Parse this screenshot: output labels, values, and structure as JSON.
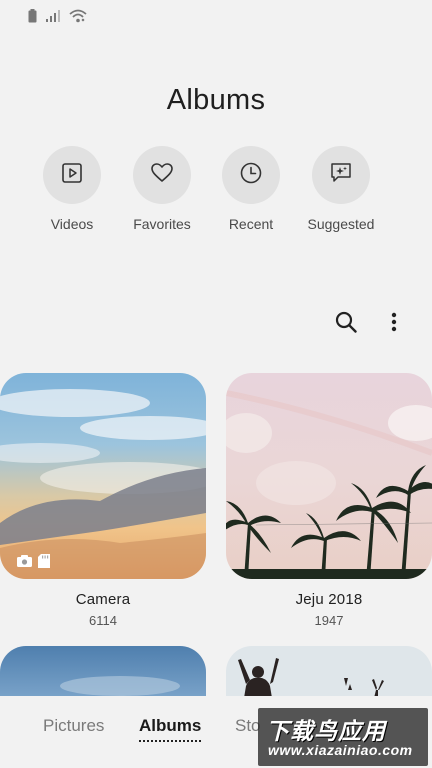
{
  "status_bar": {
    "icons": [
      "battery-icon",
      "cellular-signal-icon",
      "wifi-icon"
    ]
  },
  "header": {
    "title": "Albums"
  },
  "shortcuts": [
    {
      "label": "Videos",
      "icon": "video-play-icon"
    },
    {
      "label": "Favorites",
      "icon": "heart-icon"
    },
    {
      "label": "Recent",
      "icon": "clock-icon"
    },
    {
      "label": "Suggested",
      "icon": "sparkle-chat-icon"
    }
  ],
  "toolbar": {
    "icons": [
      "search-icon",
      "more-options-icon"
    ]
  },
  "albums": [
    {
      "name": "Camera",
      "count": "6114",
      "badges": [
        "camera-icon",
        "sd-card-icon"
      ]
    },
    {
      "name": "Jeju 2018",
      "count": "1947"
    },
    {
      "name": "",
      "count": ""
    },
    {
      "name": "",
      "count": ""
    }
  ],
  "bottom_nav": {
    "tabs": [
      {
        "label": "Pictures",
        "active": false
      },
      {
        "label": "Albums",
        "active": true
      },
      {
        "label": "Sto",
        "active": false
      }
    ]
  },
  "watermark": {
    "main": "下载鸟应用",
    "sub": "www.xiazainiao.com"
  },
  "colors": {
    "background": "#f2f2f2",
    "shortcut_circle": "#e1e1e1",
    "text_primary": "#222222",
    "text_secondary": "#555555"
  }
}
